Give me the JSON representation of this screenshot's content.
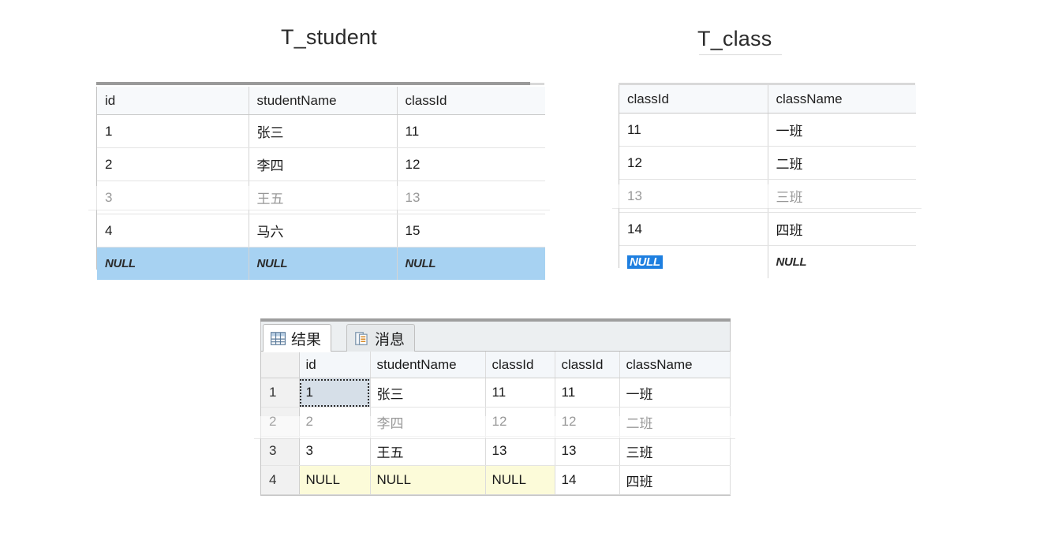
{
  "titles": {
    "student": "T_student",
    "class": "T_class"
  },
  "t_student": {
    "columns": [
      "id",
      "studentName",
      "classId"
    ],
    "rows": [
      [
        "1",
        "张三",
        "11"
      ],
      [
        "2",
        "李四",
        "12"
      ],
      [
        "3",
        "王五",
        "13"
      ],
      [
        "4",
        "马六",
        "15"
      ]
    ],
    "new_row": [
      "NULL",
      "NULL",
      "NULL"
    ],
    "new_row_highlight_color": "#a7d2f2"
  },
  "t_class": {
    "columns": [
      "classId",
      "className"
    ],
    "rows": [
      [
        "11",
        "一班"
      ],
      [
        "12",
        "二班"
      ],
      [
        "13",
        "三班"
      ],
      [
        "14",
        "四班"
      ]
    ],
    "new_row": [
      "NULL",
      "NULL"
    ],
    "selected_cell_color": "#1e7fe0"
  },
  "results_pane": {
    "tabs": [
      {
        "label": "结果",
        "icon": "results-grid-icon",
        "active": true
      },
      {
        "label": "消息",
        "icon": "messages-document-icon",
        "active": false
      }
    ],
    "grid": {
      "rownum_header": "",
      "columns": [
        "id",
        "studentName",
        "classId",
        "classId",
        "className"
      ],
      "rows": [
        {
          "n": "1",
          "cells": [
            "1",
            "张三",
            "11",
            "11",
            "一班"
          ],
          "null_flags": [
            false,
            false,
            false,
            false,
            false
          ],
          "focus_index": 0
        },
        {
          "n": "2",
          "cells": [
            "2",
            "李四",
            "12",
            "12",
            "二班"
          ],
          "null_flags": [
            false,
            false,
            false,
            false,
            false
          ],
          "focus_index": -1
        },
        {
          "n": "3",
          "cells": [
            "3",
            "王五",
            "13",
            "13",
            "三班"
          ],
          "null_flags": [
            false,
            false,
            false,
            false,
            false
          ],
          "focus_index": -1
        },
        {
          "n": "4",
          "cells": [
            "NULL",
            "NULL",
            "NULL",
            "14",
            "四班"
          ],
          "null_flags": [
            true,
            true,
            true,
            false,
            false
          ],
          "focus_index": -1
        }
      ],
      "null_cell_color": "#fcfbd9",
      "focus_cell_color": "#d6dfe8"
    }
  }
}
